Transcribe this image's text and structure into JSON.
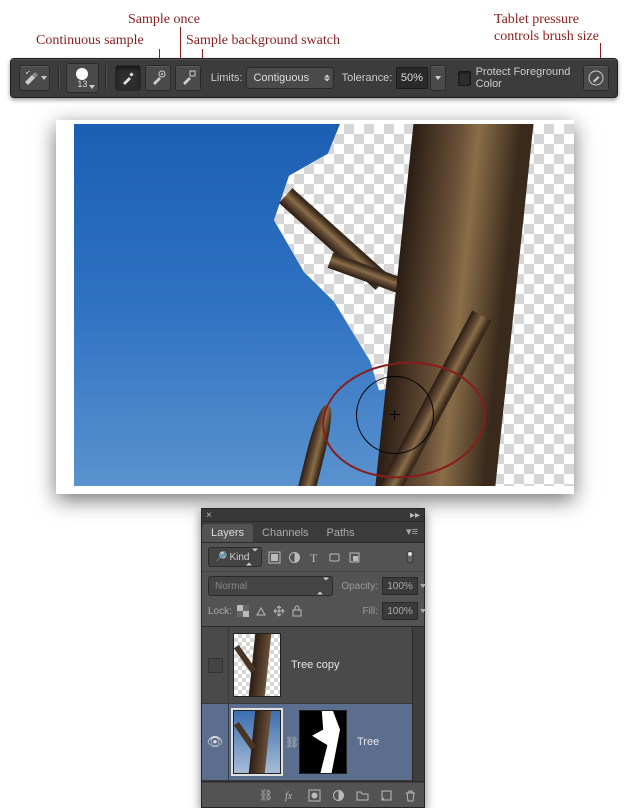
{
  "annotations": {
    "continuous_sample": "Continuous sample",
    "sample_once": "Sample once",
    "sample_bg_swatch": "Sample background swatch",
    "tablet_pressure": "Tablet pressure\ncontrols brush size"
  },
  "options_bar": {
    "brush_size": "13",
    "limits_label": "Limits:",
    "limits_value": "Contiguous",
    "tolerance_label": "Tolerance:",
    "tolerance_value": "50%",
    "protect_fg_label": "Protect Foreground Color"
  },
  "layers_panel": {
    "tabs": {
      "layers": "Layers",
      "channels": "Channels",
      "paths": "Paths"
    },
    "filter_kind": "Kind",
    "blend_mode": "Normal",
    "opacity_label": "Opacity:",
    "opacity_value": "100%",
    "lock_label": "Lock:",
    "fill_label": "Fill:",
    "fill_value": "100%",
    "layers": [
      {
        "name": "Tree copy",
        "visible": false,
        "selected": false,
        "has_mask": false
      },
      {
        "name": "Tree",
        "visible": true,
        "selected": true,
        "has_mask": true
      }
    ],
    "filter_search_icon": "▦"
  }
}
